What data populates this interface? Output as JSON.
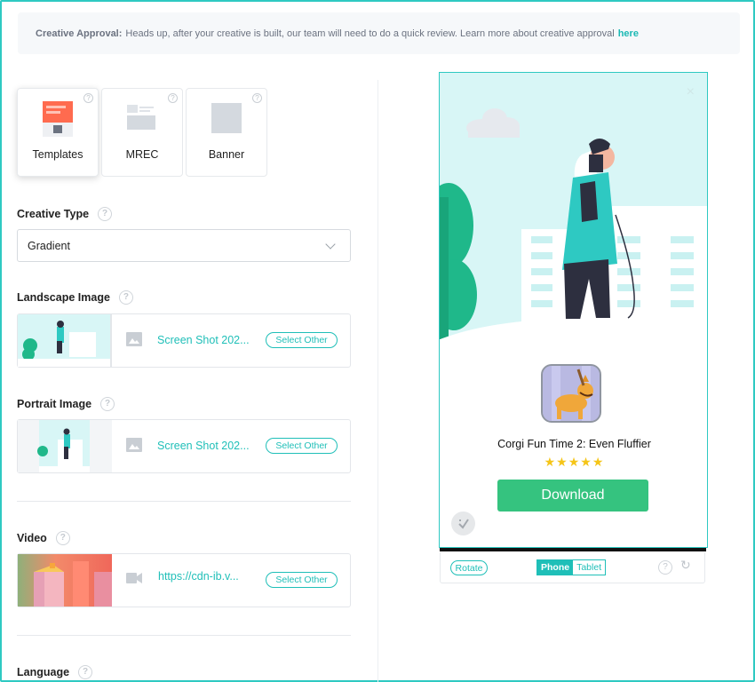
{
  "notice": {
    "title": "Creative Approval:",
    "text": "Heads up, after your creative is built, our team will need to do a quick review. Learn more about creative approval",
    "link": "here"
  },
  "formats": [
    {
      "label": "Templates",
      "active": true
    },
    {
      "label": "MREC",
      "active": false
    },
    {
      "label": "Banner",
      "active": false
    }
  ],
  "creative_type": {
    "label": "Creative Type",
    "value": "Gradient"
  },
  "landscape": {
    "label": "Landscape Image",
    "filename": "Screen Shot 202...",
    "button": "Select Other"
  },
  "portrait": {
    "label": "Portrait Image",
    "filename": "Screen Shot 202...",
    "button": "Select Other"
  },
  "video": {
    "label": "Video",
    "url": "https://cdn-ib.v...",
    "button": "Select Other"
  },
  "language": {
    "label": "Language"
  },
  "preview": {
    "close": "×",
    "app_title": "Corgi Fun Time 2: Even Fluffier",
    "stars": "★★★★★",
    "rating": 5,
    "download": "Download",
    "controls": {
      "rotate": "Rotate",
      "phone": "Phone",
      "tablet": "Tablet"
    }
  },
  "colors": {
    "accent": "#1fbfb8",
    "download": "#35c37f",
    "star": "#f5c518"
  }
}
